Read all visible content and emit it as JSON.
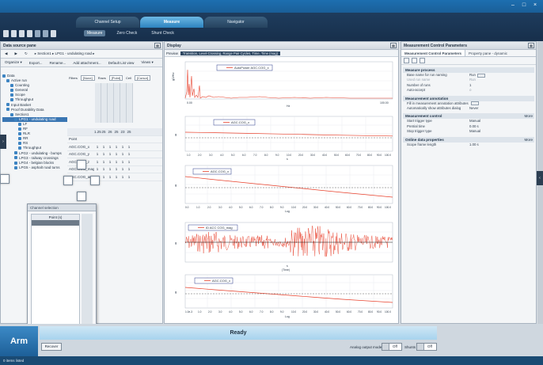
{
  "main_tabs": [
    "Channel Setup",
    "Measure",
    "Navigator"
  ],
  "sub_tabs": [
    "Measure",
    "Zero Check",
    "Shunt Check"
  ],
  "left_panel": {
    "title": "Data source pane",
    "breadcrumb": "▸ Section1 ▸ LPG1 - undulating road ▸",
    "toolbar2": [
      "Organize ▾",
      "Export...",
      "Rename...",
      "Add attachment...",
      "Default List view",
      "Views ▾"
    ],
    "tree": [
      {
        "label": "Data",
        "indent": 0,
        "selected": false
      },
      {
        "label": "Active run",
        "indent": 1,
        "selected": false
      },
      {
        "label": "Counting",
        "indent": 2,
        "selected": false
      },
      {
        "label": "General",
        "indent": 2,
        "selected": false
      },
      {
        "label": "Scope",
        "indent": 2,
        "selected": false
      },
      {
        "label": "Throughput",
        "indent": 2,
        "selected": false
      },
      {
        "label": "Input Basket",
        "indent": 1,
        "selected": false
      },
      {
        "label": "Proof Durability Data",
        "indent": 1,
        "selected": false
      },
      {
        "label": "Section1",
        "indent": 2,
        "selected": false
      },
      {
        "label": "LPG1 - undulating road",
        "indent": 3,
        "selected": true
      },
      {
        "label": "LF",
        "indent": 4,
        "selected": false
      },
      {
        "label": "RF",
        "indent": 4,
        "selected": false
      },
      {
        "label": "RLR",
        "indent": 4,
        "selected": false
      },
      {
        "label": "RR",
        "indent": 4,
        "selected": false
      },
      {
        "label": "RS",
        "indent": 4,
        "selected": false
      },
      {
        "label": "Throughput",
        "indent": 4,
        "selected": false
      },
      {
        "label": "LPG2 - undulating - bumps",
        "indent": 3,
        "selected": false
      },
      {
        "label": "LPG3 - railway crossings",
        "indent": 3,
        "selected": false
      },
      {
        "label": "LPG4 - belgian blocks",
        "indent": 3,
        "selected": false
      },
      {
        "label": "LPG5 - asphalt road turns",
        "indent": 3,
        "selected": false
      }
    ],
    "grid_filters": [
      "Filters",
      "[None]",
      "Rows",
      "[Point]",
      "Cell",
      "[Cursor]"
    ],
    "grid_header_numbers": [
      "1.25",
      "25",
      "26",
      "25",
      "23",
      "25"
    ],
    "grid_rows": [
      {
        "name": "Point",
        "cells": []
      },
      {
        "name": "AGC.COG_x",
        "cells": [
          "1",
          "1",
          "1",
          "1",
          "1",
          "1"
        ]
      },
      {
        "name": "AGC.COG_y",
        "cells": [
          "1",
          "1",
          "1",
          "1",
          "1",
          "1"
        ]
      },
      {
        "name": "AGC.COG_z",
        "cells": [
          "1",
          "1",
          "1",
          "1",
          "1",
          "1"
        ]
      },
      {
        "name": "AGC.COG_mag",
        "cells": [
          "1",
          "1",
          "1",
          "1",
          "1",
          "1"
        ]
      },
      {
        "name": "AGC.COG_ang",
        "cells": [
          "1",
          "1",
          "1",
          "1",
          "1",
          "1"
        ]
      }
    ],
    "float_dialog": {
      "title": "Channel selection",
      "list_header": "Point (s)",
      "footer": "Ref"
    }
  },
  "display": {
    "title": "Display",
    "strip_label": "Preview",
    "strip_hint": "Transition, Level Crossing, Range Pair Cycles, Time, Time (mag)",
    "plots": [
      {
        "legend": "AutoPower AGC.COG_x",
        "ylabel": "g2/Hz",
        "xlabel": "Hz",
        "xticks": [
          "0.00",
          "",
          "",
          "",
          "",
          "",
          "",
          "",
          "",
          "",
          "",
          "",
          "",
          "",
          "",
          "",
          "",
          "",
          "",
          "",
          "",
          "",
          "",
          "",
          "",
          "100.00"
        ]
      },
      {
        "legend": "AGC.COG_x",
        "ylabel": "g",
        "xlabel": "s",
        "xticks": [
          "1.0",
          "2.0",
          "3.0",
          "4.0",
          "5.0",
          "6.0",
          "7.0",
          "8.0",
          "9.0",
          "10.0",
          "20.0",
          "30.0",
          "40.0",
          "50.0",
          "60.0",
          "70.0",
          "80.0",
          "90.0",
          "100.0"
        ]
      },
      {
        "legend": "AGC.COG_x",
        "ylabel": "g",
        "xlabel": "Log",
        "xticks": [
          "0.0",
          "1.0",
          "2.0",
          "3.0",
          "4.0",
          "5.0",
          "6.0",
          "7.0",
          "8.0",
          "9.0",
          "10.0",
          "20.0",
          "30.0",
          "40.0",
          "50.0",
          "60.0",
          "70.0",
          "80.0",
          "90.0",
          "100.0"
        ]
      },
      {
        "legend": "ID ACC COG_mag",
        "ylabel": "g",
        "xlabel": "s",
        "xunits": "(Time)"
      },
      {
        "legend": "AGC.COG_x",
        "ylabel": "g",
        "xlabel": "Log",
        "xticks": [
          "1.0e-3",
          "1.0",
          "2.0",
          "3.0",
          "4.0",
          "5.0",
          "6.0",
          "7.0",
          "8.0",
          "9.0",
          "10.0",
          "20.0",
          "30.0",
          "40.0",
          "50.0",
          "60.0",
          "70.0",
          "80.0",
          "90.0",
          "100.0"
        ]
      }
    ]
  },
  "right_panel": {
    "title": "Measurement Control Parameters",
    "tabs": [
      "Measurement Control Parameters",
      "Property pane - dynamic"
    ],
    "sections": [
      {
        "title": "Measure process",
        "more": "",
        "rows": [
          {
            "k": "Base name for run naming",
            "v": "Run",
            "button": true,
            "dim": false
          },
          {
            "k": "Used run name",
            "v": "Run",
            "button": false,
            "dim": true
          },
          {
            "k": "Number of runs",
            "v": "1",
            "button": false,
            "dim": false
          },
          {
            "k": "Auto-accept",
            "v": "○",
            "button": false,
            "dim": false
          }
        ]
      },
      {
        "title": "Measurement annotation",
        "more": "",
        "rows": [
          {
            "k": "Fill in measurement annotation attributes",
            "v": "",
            "button": true,
            "dim": false
          },
          {
            "k": "Automatically show attributes dialog",
            "v": "Never",
            "button": false,
            "dim": false
          }
        ]
      },
      {
        "title": "Measurement control",
        "more": "More",
        "rows": [
          {
            "k": "Start trigger type",
            "v": "Manual",
            "button": false,
            "dim": false
          },
          {
            "k": "Pretrial time",
            "v": "0.00 s",
            "button": false,
            "dim": false
          },
          {
            "k": "Stop trigger type",
            "v": "Manual",
            "button": false,
            "dim": false
          }
        ]
      },
      {
        "title": "Online data properties",
        "more": "More",
        "rows": [
          {
            "k": "Scope frame length",
            "v": "1.00 s",
            "button": false,
            "dim": false
          }
        ]
      }
    ],
    "side_label": "Processing"
  },
  "bottom": {
    "arm_label": "Arm",
    "status": "Ready",
    "recover_label": "Recover",
    "analog_label": "Analog output mode",
    "analog_value": "Off",
    "shunts_label": "Shunts",
    "shunts_value": "Off"
  },
  "statusbar": {
    "text": "0 items listed"
  },
  "colors": {
    "accent": "#2d83bf",
    "signal": "#e8412c",
    "ready": "#a7d3ee"
  }
}
